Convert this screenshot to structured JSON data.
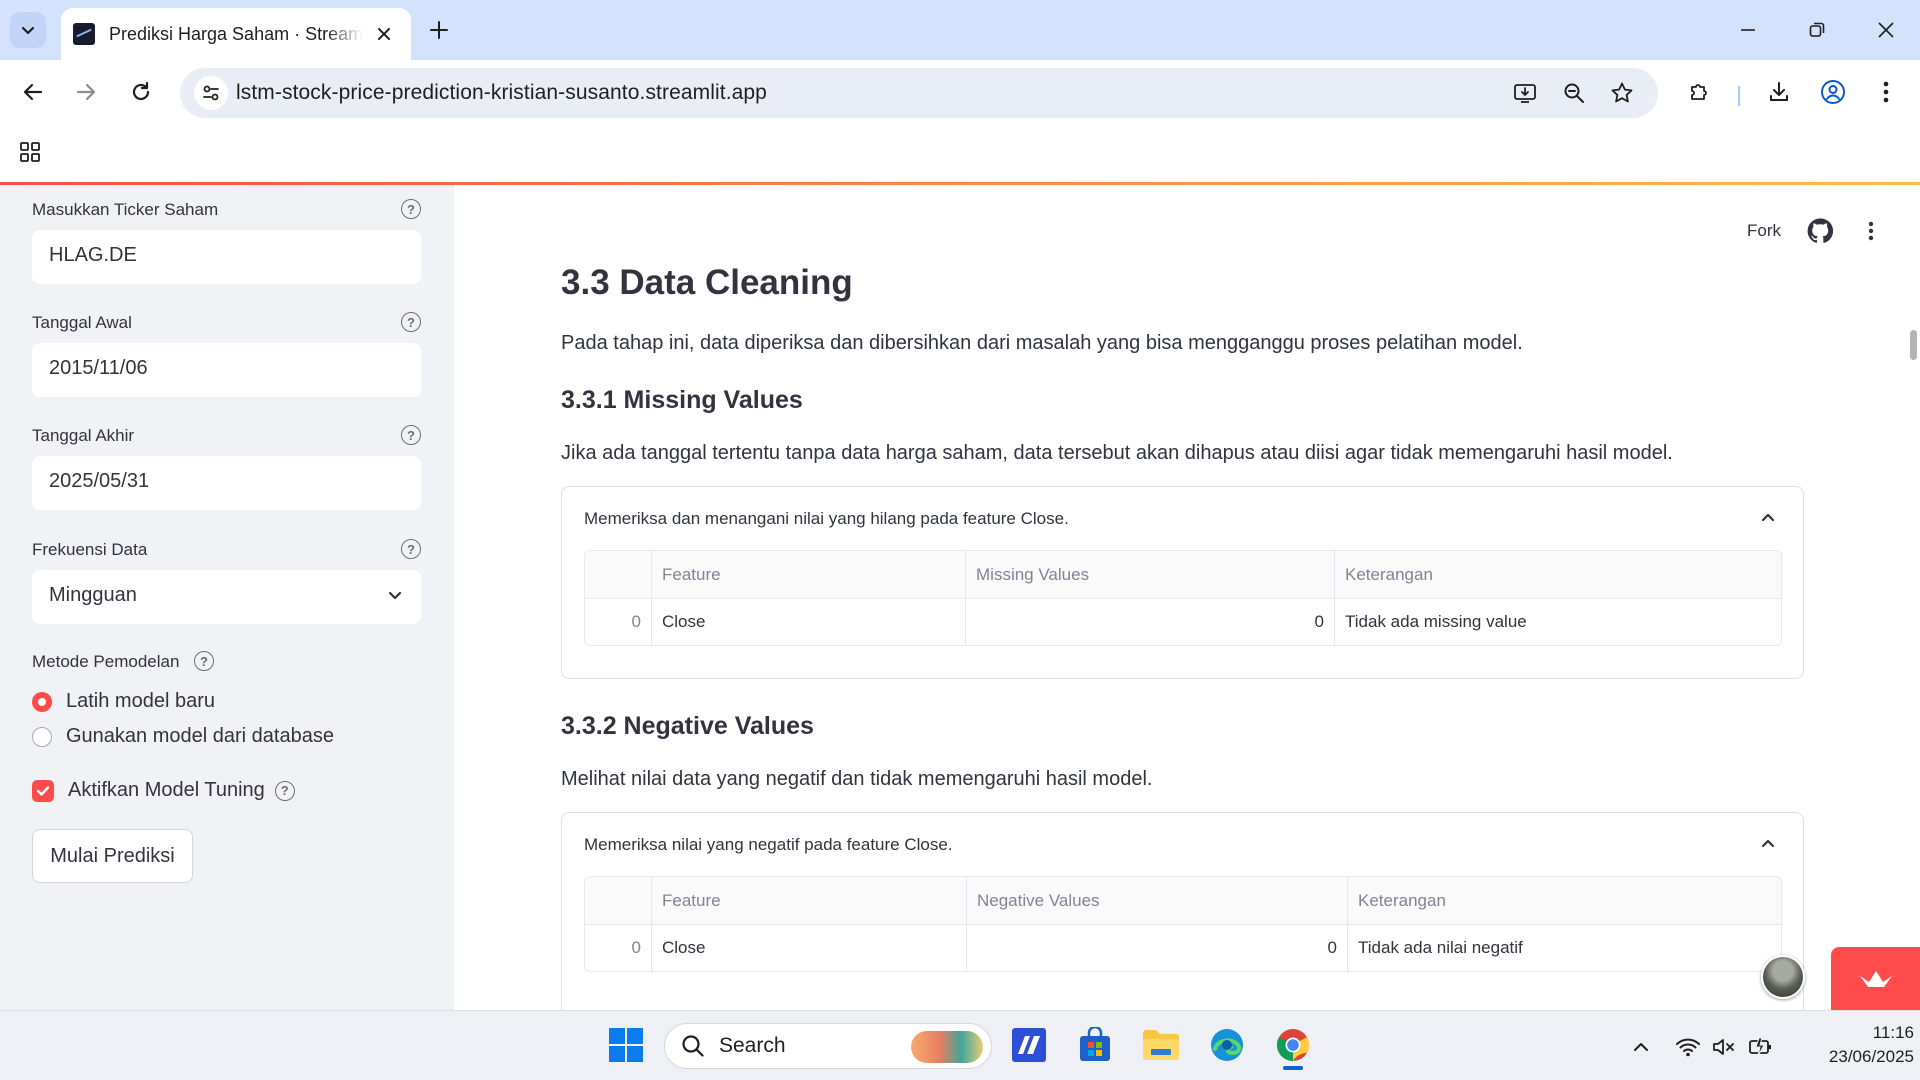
{
  "browser": {
    "tab_title": "Prediksi Harga Saham · Streamlit",
    "url": "lstm-stock-price-prediction-kristian-susanto.streamlit.app"
  },
  "sidebar": {
    "ticker": {
      "label": "Masukkan Ticker Saham",
      "value": "HLAG.DE"
    },
    "start_date": {
      "label": "Tanggal Awal",
      "value": "2015/11/06"
    },
    "end_date": {
      "label": "Tanggal Akhir",
      "value": "2025/05/31"
    },
    "frequency": {
      "label": "Frekuensi Data",
      "value": "Mingguan"
    },
    "method": {
      "label": "Metode Pemodelan",
      "options": [
        "Latih model baru",
        "Gunakan model dari database"
      ],
      "selected": "Latih model baru"
    },
    "tuning": {
      "label": "Aktifkan Model Tuning",
      "checked": true
    },
    "button": "Mulai Prediksi"
  },
  "header": {
    "fork": "Fork"
  },
  "main": {
    "section_title": "3.3 Data Cleaning",
    "section_intro": "Pada tahap ini, data diperiksa dan dibersihkan dari masalah yang bisa mengganggu proses pelatihan model.",
    "missing": {
      "title": "3.3.1 Missing Values",
      "desc": "Jika ada tanggal tertentu tanpa data harga saham, data tersebut akan dihapus atau diisi agar tidak memengaruhi hasil model.",
      "expander": "Memeriksa dan menangani nilai yang hilang pada feature Close.",
      "columns": [
        "Feature",
        "Missing Values",
        "Keterangan"
      ],
      "rows": [
        {
          "index": "0",
          "feature": "Close",
          "value": "0",
          "note": "Tidak ada missing value"
        }
      ]
    },
    "negative": {
      "title": "3.3.2 Negative Values",
      "desc": "Melihat nilai data yang negatif dan tidak memengaruhi hasil model.",
      "expander": "Memeriksa nilai yang negatif pada feature Close.",
      "columns": [
        "Feature",
        "Negative Values",
        "Keterangan"
      ],
      "rows": [
        {
          "index": "0",
          "feature": "Close",
          "value": "0",
          "note": "Tidak ada nilai negatif"
        }
      ]
    }
  },
  "taskbar": {
    "search": "Search",
    "time": "11:16",
    "date": "23/06/2025"
  },
  "colors": {
    "accent": "#ff4b4b",
    "sidebar_bg": "#f0f2f6",
    "tabstrip_bg": "#d3e3fd"
  }
}
